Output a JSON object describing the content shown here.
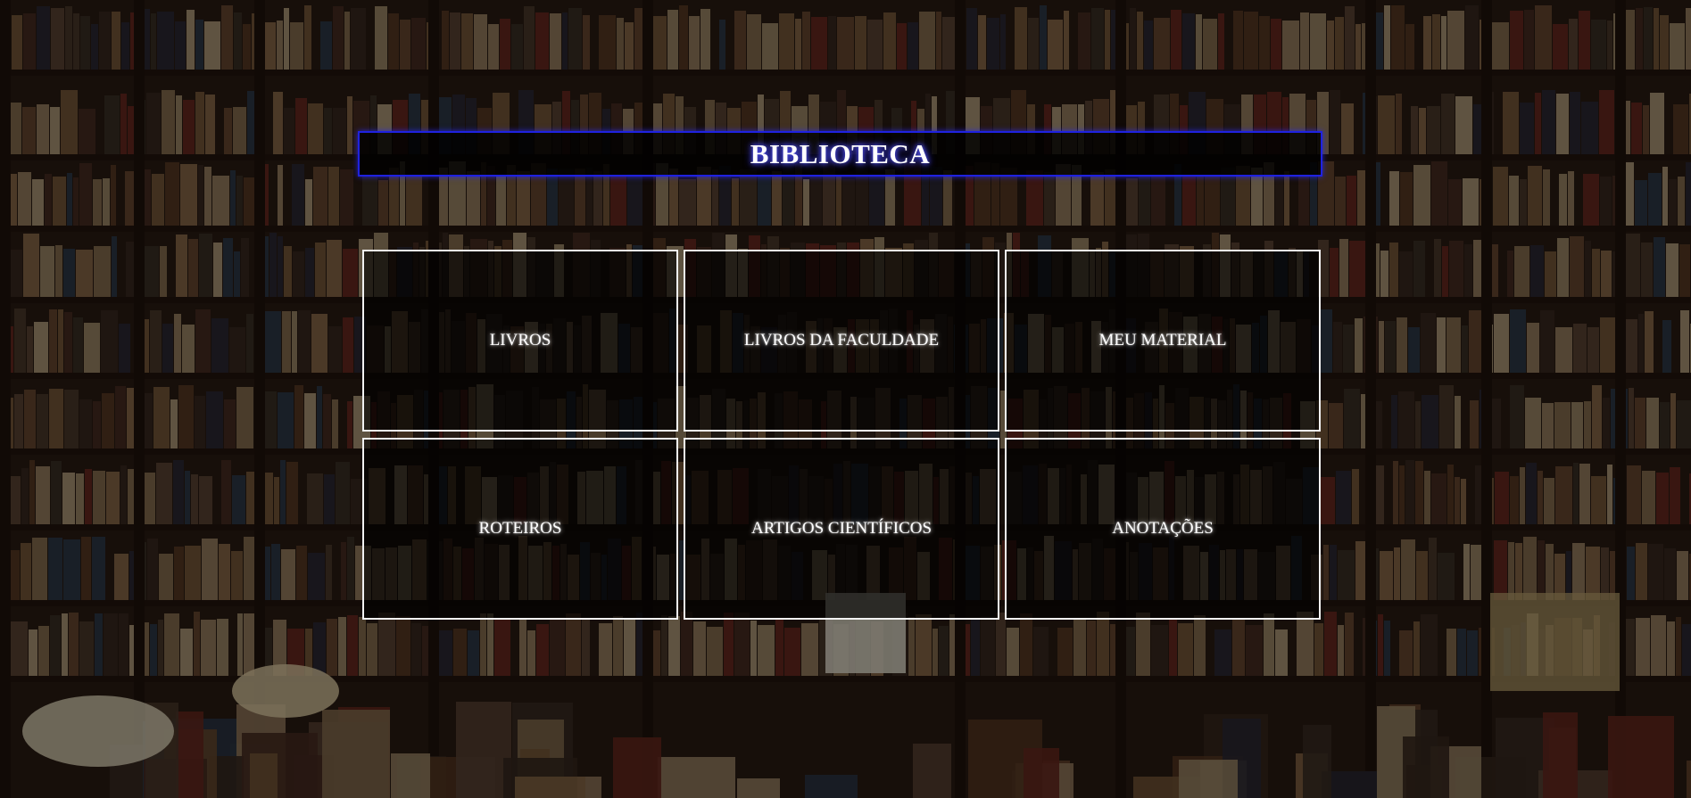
{
  "header": {
    "title": "BIBLIOTECA"
  },
  "menu": {
    "items": [
      {
        "label": "LIVROS"
      },
      {
        "label": "LIVROS DA FACULDADE"
      },
      {
        "label": "MEU MATERIAL"
      },
      {
        "label": "ROTEIROS"
      },
      {
        "label": "ARTIGOS CIENTÍFICOS"
      },
      {
        "label": "ANOTAÇÕES"
      }
    ]
  },
  "colors": {
    "title_border": "#1f22e0",
    "tile_border": "#f2f2f2",
    "text": "#ffffff"
  }
}
